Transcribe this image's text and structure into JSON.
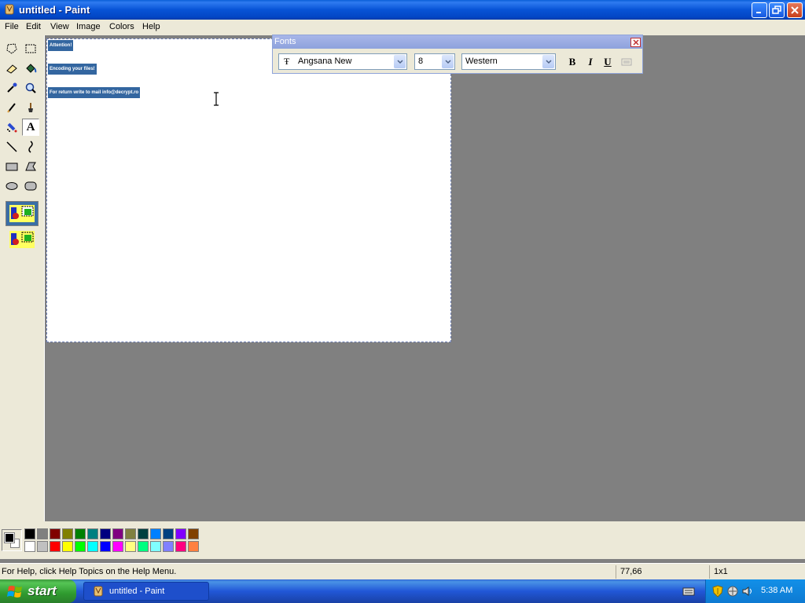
{
  "window": {
    "title": "untitled - Paint"
  },
  "menu": [
    "File",
    "Edit",
    "View",
    "Image",
    "Colors",
    "Help"
  ],
  "canvas": {
    "texts": [
      "Attention!",
      "Encoding your files!",
      "For return write to mail info@decrypt.ro"
    ]
  },
  "fonts_toolbar": {
    "title": "Fonts",
    "font_name": "Angsana New",
    "font_size": "8",
    "script": "Western",
    "bold_label": "B",
    "italic_label": "I",
    "underline_label": "U"
  },
  "palette": {
    "foreground": "#000000",
    "background": "#ffffff",
    "colors_row1": [
      "#000000",
      "#808080",
      "#800000",
      "#808000",
      "#008000",
      "#008080",
      "#000080",
      "#800080",
      "#808040",
      "#004040",
      "#0080ff",
      "#004080",
      "#8000ff",
      "#804000"
    ],
    "colors_row2": [
      "#ffffff",
      "#c0c0c0",
      "#ff0000",
      "#ffff00",
      "#00ff00",
      "#00ffff",
      "#0000ff",
      "#ff00ff",
      "#ffff80",
      "#00ff80",
      "#80ffff",
      "#8080ff",
      "#ff0080",
      "#ff8040"
    ]
  },
  "status": {
    "help": "For Help, click Help Topics on the Help Menu.",
    "coords": "77,66",
    "size": "1x1"
  },
  "taskbar": {
    "start_label": "start",
    "task_label": "untitled - Paint",
    "clock": "5:38 AM"
  }
}
